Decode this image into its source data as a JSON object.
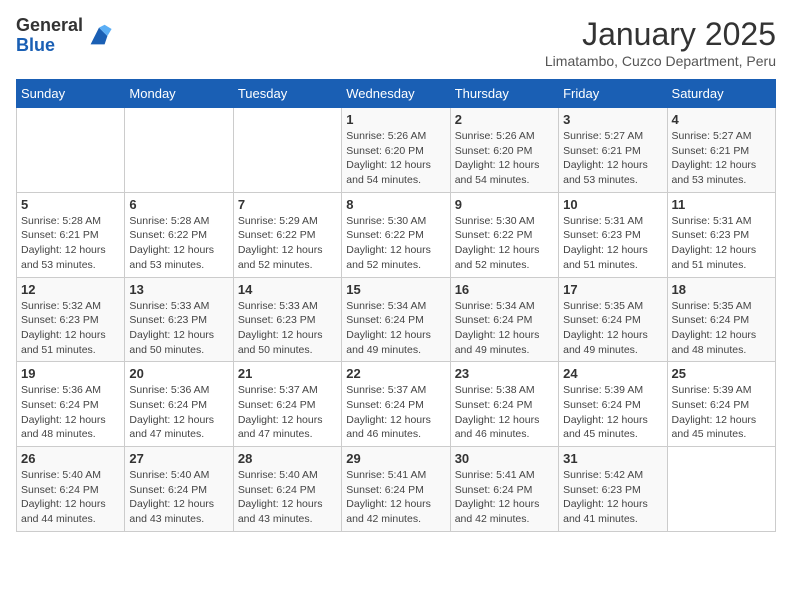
{
  "logo": {
    "general": "General",
    "blue": "Blue"
  },
  "title": "January 2025",
  "subtitle": "Limatambo, Cuzco Department, Peru",
  "days_of_week": [
    "Sunday",
    "Monday",
    "Tuesday",
    "Wednesday",
    "Thursday",
    "Friday",
    "Saturday"
  ],
  "weeks": [
    [
      {
        "day": "",
        "detail": ""
      },
      {
        "day": "",
        "detail": ""
      },
      {
        "day": "",
        "detail": ""
      },
      {
        "day": "1",
        "detail": "Sunrise: 5:26 AM\nSunset: 6:20 PM\nDaylight: 12 hours\nand 54 minutes."
      },
      {
        "day": "2",
        "detail": "Sunrise: 5:26 AM\nSunset: 6:20 PM\nDaylight: 12 hours\nand 54 minutes."
      },
      {
        "day": "3",
        "detail": "Sunrise: 5:27 AM\nSunset: 6:21 PM\nDaylight: 12 hours\nand 53 minutes."
      },
      {
        "day": "4",
        "detail": "Sunrise: 5:27 AM\nSunset: 6:21 PM\nDaylight: 12 hours\nand 53 minutes."
      }
    ],
    [
      {
        "day": "5",
        "detail": "Sunrise: 5:28 AM\nSunset: 6:21 PM\nDaylight: 12 hours\nand 53 minutes."
      },
      {
        "day": "6",
        "detail": "Sunrise: 5:28 AM\nSunset: 6:22 PM\nDaylight: 12 hours\nand 53 minutes."
      },
      {
        "day": "7",
        "detail": "Sunrise: 5:29 AM\nSunset: 6:22 PM\nDaylight: 12 hours\nand 52 minutes."
      },
      {
        "day": "8",
        "detail": "Sunrise: 5:30 AM\nSunset: 6:22 PM\nDaylight: 12 hours\nand 52 minutes."
      },
      {
        "day": "9",
        "detail": "Sunrise: 5:30 AM\nSunset: 6:22 PM\nDaylight: 12 hours\nand 52 minutes."
      },
      {
        "day": "10",
        "detail": "Sunrise: 5:31 AM\nSunset: 6:23 PM\nDaylight: 12 hours\nand 51 minutes."
      },
      {
        "day": "11",
        "detail": "Sunrise: 5:31 AM\nSunset: 6:23 PM\nDaylight: 12 hours\nand 51 minutes."
      }
    ],
    [
      {
        "day": "12",
        "detail": "Sunrise: 5:32 AM\nSunset: 6:23 PM\nDaylight: 12 hours\nand 51 minutes."
      },
      {
        "day": "13",
        "detail": "Sunrise: 5:33 AM\nSunset: 6:23 PM\nDaylight: 12 hours\nand 50 minutes."
      },
      {
        "day": "14",
        "detail": "Sunrise: 5:33 AM\nSunset: 6:23 PM\nDaylight: 12 hours\nand 50 minutes."
      },
      {
        "day": "15",
        "detail": "Sunrise: 5:34 AM\nSunset: 6:24 PM\nDaylight: 12 hours\nand 49 minutes."
      },
      {
        "day": "16",
        "detail": "Sunrise: 5:34 AM\nSunset: 6:24 PM\nDaylight: 12 hours\nand 49 minutes."
      },
      {
        "day": "17",
        "detail": "Sunrise: 5:35 AM\nSunset: 6:24 PM\nDaylight: 12 hours\nand 49 minutes."
      },
      {
        "day": "18",
        "detail": "Sunrise: 5:35 AM\nSunset: 6:24 PM\nDaylight: 12 hours\nand 48 minutes."
      }
    ],
    [
      {
        "day": "19",
        "detail": "Sunrise: 5:36 AM\nSunset: 6:24 PM\nDaylight: 12 hours\nand 48 minutes."
      },
      {
        "day": "20",
        "detail": "Sunrise: 5:36 AM\nSunset: 6:24 PM\nDaylight: 12 hours\nand 47 minutes."
      },
      {
        "day": "21",
        "detail": "Sunrise: 5:37 AM\nSunset: 6:24 PM\nDaylight: 12 hours\nand 47 minutes."
      },
      {
        "day": "22",
        "detail": "Sunrise: 5:37 AM\nSunset: 6:24 PM\nDaylight: 12 hours\nand 46 minutes."
      },
      {
        "day": "23",
        "detail": "Sunrise: 5:38 AM\nSunset: 6:24 PM\nDaylight: 12 hours\nand 46 minutes."
      },
      {
        "day": "24",
        "detail": "Sunrise: 5:39 AM\nSunset: 6:24 PM\nDaylight: 12 hours\nand 45 minutes."
      },
      {
        "day": "25",
        "detail": "Sunrise: 5:39 AM\nSunset: 6:24 PM\nDaylight: 12 hours\nand 45 minutes."
      }
    ],
    [
      {
        "day": "26",
        "detail": "Sunrise: 5:40 AM\nSunset: 6:24 PM\nDaylight: 12 hours\nand 44 minutes."
      },
      {
        "day": "27",
        "detail": "Sunrise: 5:40 AM\nSunset: 6:24 PM\nDaylight: 12 hours\nand 43 minutes."
      },
      {
        "day": "28",
        "detail": "Sunrise: 5:40 AM\nSunset: 6:24 PM\nDaylight: 12 hours\nand 43 minutes."
      },
      {
        "day": "29",
        "detail": "Sunrise: 5:41 AM\nSunset: 6:24 PM\nDaylight: 12 hours\nand 42 minutes."
      },
      {
        "day": "30",
        "detail": "Sunrise: 5:41 AM\nSunset: 6:24 PM\nDaylight: 12 hours\nand 42 minutes."
      },
      {
        "day": "31",
        "detail": "Sunrise: 5:42 AM\nSunset: 6:23 PM\nDaylight: 12 hours\nand 41 minutes."
      },
      {
        "day": "",
        "detail": ""
      }
    ]
  ]
}
